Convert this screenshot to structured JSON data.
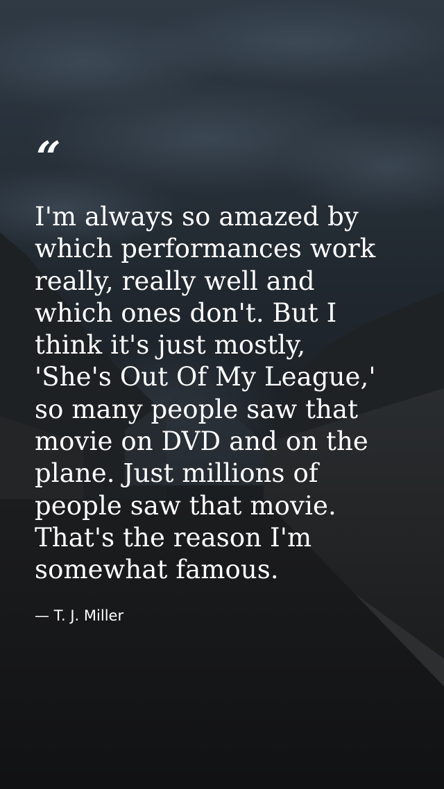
{
  "quote": {
    "mark": "“",
    "lines": [
      "I'm always so amazed by",
      "which performances work",
      "really, really well and",
      "which ones don't. But I",
      "think it's just mostly,",
      "'She's Out Of My League,'",
      "so many people saw that",
      "movie on DVD and on the",
      "plane. Just millions of",
      "people saw that movie.",
      "That's the reason I'm",
      "somewhat famous."
    ],
    "author": "— T. J. Miller"
  },
  "colors": {
    "text": "#ffffff",
    "sky": "#2f3a45",
    "ground": "#131415"
  }
}
